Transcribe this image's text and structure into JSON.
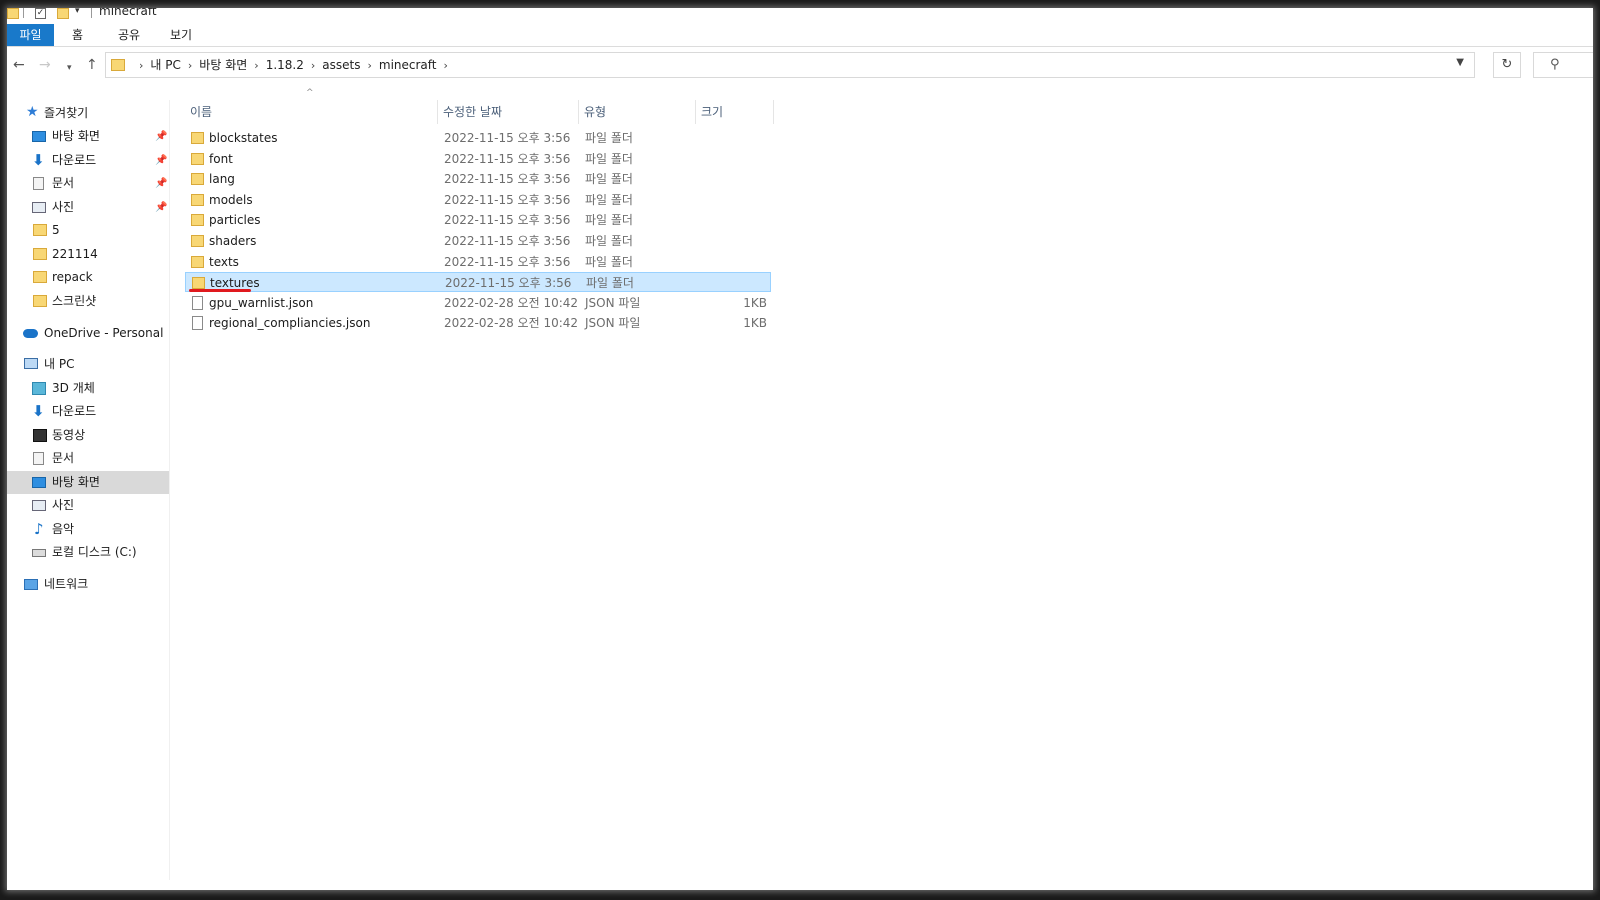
{
  "window": {
    "title": "minecraft"
  },
  "ribbon": {
    "tabs": [
      "파일",
      "홈",
      "공유",
      "보기"
    ]
  },
  "address": {
    "crumbs": [
      "내 PC",
      "바탕 화면",
      "1.18.2",
      "assets",
      "minecraft"
    ]
  },
  "sidebar": {
    "items": [
      {
        "label": "즐겨찾기",
        "icon": "star-icon"
      },
      {
        "label": "바탕 화면",
        "icon": "desktop-icon",
        "pinned": true
      },
      {
        "label": "다운로드",
        "icon": "download-icon",
        "pinned": true
      },
      {
        "label": "문서",
        "icon": "document-icon",
        "pinned": true
      },
      {
        "label": "사진",
        "icon": "pictures-icon",
        "pinned": true
      },
      {
        "label": "5",
        "icon": "folder-icon"
      },
      {
        "label": "221114",
        "icon": "folder-icon"
      },
      {
        "label": "repack",
        "icon": "folder-icon"
      },
      {
        "label": "스크린샷",
        "icon": "folder-icon"
      },
      {
        "label": "OneDrive - Personal",
        "icon": "onedrive-icon"
      },
      {
        "label": "내 PC",
        "icon": "pc-icon"
      },
      {
        "label": "3D 개체",
        "icon": "3d-objects-icon"
      },
      {
        "label": "다운로드",
        "icon": "download-icon"
      },
      {
        "label": "동영상",
        "icon": "video-icon"
      },
      {
        "label": "문서",
        "icon": "document-icon"
      },
      {
        "label": "바탕 화면",
        "icon": "desktop-icon",
        "selected": true
      },
      {
        "label": "사진",
        "icon": "pictures-icon"
      },
      {
        "label": "음악",
        "icon": "music-icon"
      },
      {
        "label": "로컬 디스크 (C:)",
        "icon": "drive-icon"
      },
      {
        "label": "네트워크",
        "icon": "network-icon"
      }
    ]
  },
  "columns": {
    "name": "이름",
    "date": "수정한 날짜",
    "type": "유형",
    "size": "크기"
  },
  "files": [
    {
      "name": "blockstates",
      "date": "2022-11-15 오후 3:56",
      "type": "파일 폴더",
      "size": "",
      "kind": "folder"
    },
    {
      "name": "font",
      "date": "2022-11-15 오후 3:56",
      "type": "파일 폴더",
      "size": "",
      "kind": "folder"
    },
    {
      "name": "lang",
      "date": "2022-11-15 오후 3:56",
      "type": "파일 폴더",
      "size": "",
      "kind": "folder"
    },
    {
      "name": "models",
      "date": "2022-11-15 오후 3:56",
      "type": "파일 폴더",
      "size": "",
      "kind": "folder"
    },
    {
      "name": "particles",
      "date": "2022-11-15 오후 3:56",
      "type": "파일 폴더",
      "size": "",
      "kind": "folder"
    },
    {
      "name": "shaders",
      "date": "2022-11-15 오후 3:56",
      "type": "파일 폴더",
      "size": "",
      "kind": "folder"
    },
    {
      "name": "texts",
      "date": "2022-11-15 오후 3:56",
      "type": "파일 폴더",
      "size": "",
      "kind": "folder"
    },
    {
      "name": "textures",
      "date": "2022-11-15 오후 3:56",
      "type": "파일 폴더",
      "size": "",
      "kind": "folder",
      "selected": true
    },
    {
      "name": "gpu_warnlist.json",
      "date": "2022-02-28 오전 10:42",
      "type": "JSON 파일",
      "size": "1KB",
      "kind": "file"
    },
    {
      "name": "regional_compliancies.json",
      "date": "2022-02-28 오전 10:42",
      "type": "JSON 파일",
      "size": "1KB",
      "kind": "file"
    }
  ],
  "colors": {
    "accent": "#1979ca",
    "selection": "#cce8ff",
    "annotation": "#e0191e"
  }
}
